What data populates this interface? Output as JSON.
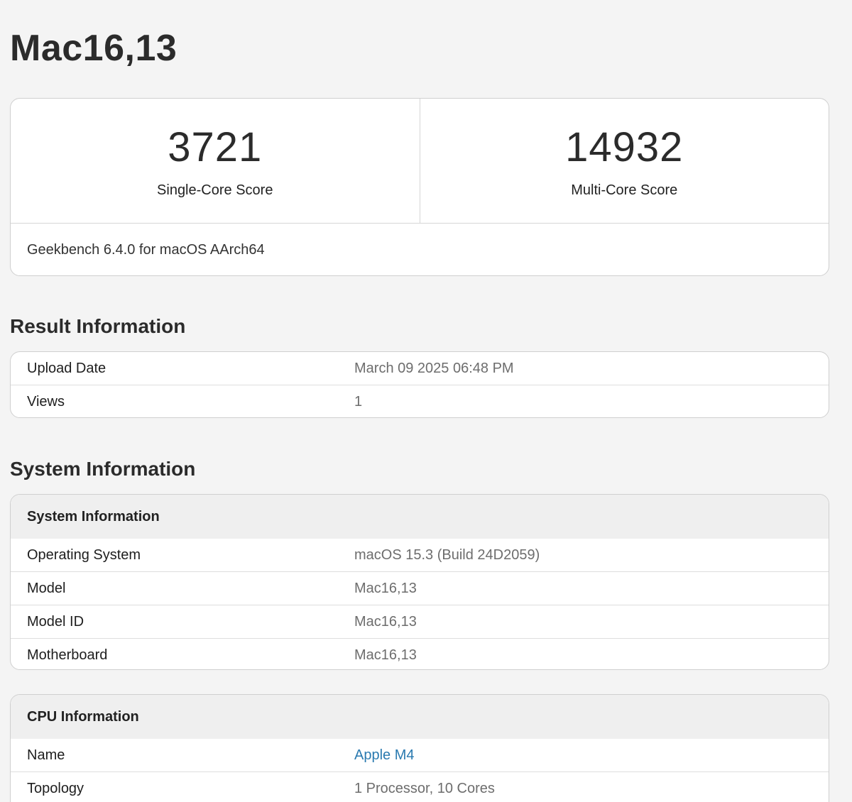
{
  "device_title": "Mac16,13",
  "scores": {
    "single_core": {
      "value": "3721",
      "label": "Single-Core Score"
    },
    "multi_core": {
      "value": "14932",
      "label": "Multi-Core Score"
    },
    "version": "Geekbench 6.4.0 for macOS AArch64"
  },
  "result_info": {
    "title": "Result Information",
    "rows": [
      {
        "key": "Upload Date",
        "value": "March 09 2025 06:48 PM"
      },
      {
        "key": "Views",
        "value": "1"
      }
    ]
  },
  "system_info": {
    "title": "System Information",
    "card_title": "System Information",
    "rows": [
      {
        "key": "Operating System",
        "value": "macOS 15.3 (Build 24D2059)"
      },
      {
        "key": "Model",
        "value": "Mac16,13"
      },
      {
        "key": "Model ID",
        "value": "Mac16,13"
      },
      {
        "key": "Motherboard",
        "value": "Mac16,13"
      }
    ]
  },
  "cpu_info": {
    "card_title": "CPU Information",
    "rows": [
      {
        "key": "Name",
        "value": "Apple M4"
      },
      {
        "key": "Topology",
        "value": "1 Processor, 10 Cores"
      }
    ]
  },
  "colors": {
    "background": "#f4f4f4",
    "link": "#2a7ab0",
    "card_header": "#efefef"
  }
}
